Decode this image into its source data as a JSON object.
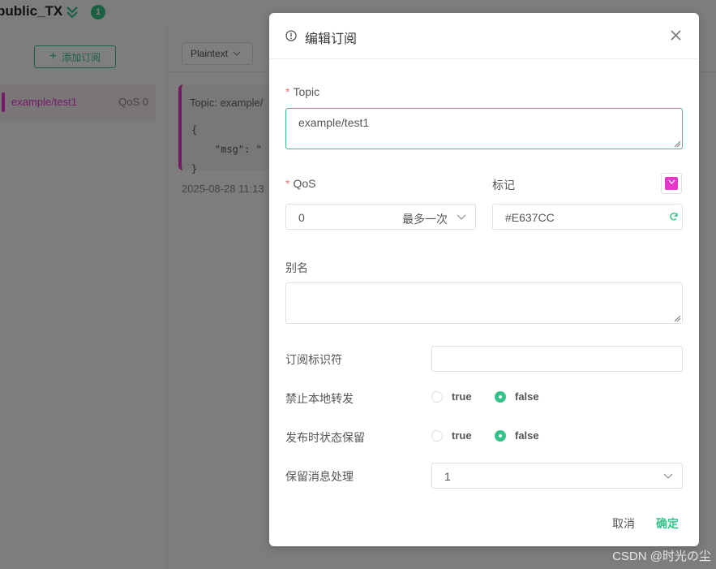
{
  "app": {
    "connection_name": "public_TX",
    "online_count": "1",
    "add_subscription_label": "添加订阅",
    "subscription": {
      "topic": "example/test1",
      "qos_label": "QoS 0",
      "color": "#E637CC"
    },
    "payload_format": "Plaintext",
    "message": {
      "topic_text": "Topic: example/",
      "body": "{\n    \"msg\": \"\n}",
      "time": "2025-08-28 11:13"
    }
  },
  "dialog": {
    "title": "编辑订阅",
    "topic": {
      "label": "Topic",
      "value": "example/test1"
    },
    "qos": {
      "label": "QoS",
      "value": "0",
      "description": "最多一次"
    },
    "mark": {
      "label": "标记",
      "value": "#E637CC"
    },
    "alias": {
      "label": "别名",
      "value": ""
    },
    "subscription_identifier": {
      "label": "订阅标识符",
      "value": ""
    },
    "no_local": {
      "label": "禁止本地转发",
      "options": [
        "true",
        "false"
      ],
      "selected": "false"
    },
    "retain_as_published": {
      "label": "发布时状态保留",
      "options": [
        "true",
        "false"
      ],
      "selected": "false"
    },
    "retain_handling": {
      "label": "保留消息处理",
      "value": "1"
    },
    "cancel_label": "取消",
    "confirm_label": "确定"
  },
  "watermark": "CSDN @时光の尘",
  "colors": {
    "accent": "#34c388",
    "required": "#f56c6c",
    "mark": "#E637CC"
  }
}
